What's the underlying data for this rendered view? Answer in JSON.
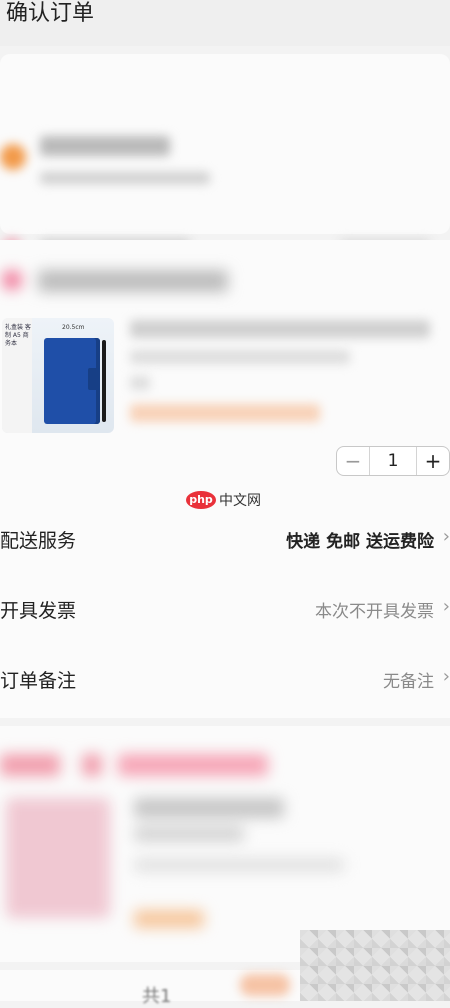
{
  "header": {
    "title": "确认订单"
  },
  "product": {
    "thumbnail": {
      "tag_text": "礼盒装 客制 A5 商务本",
      "dimension_text": "20.5cm"
    },
    "quantity": {
      "minus_icon": "−",
      "value": "1",
      "plus_icon": "+"
    }
  },
  "watermark": {
    "logo_text": "php",
    "site_text": "中文网"
  },
  "order_rows": [
    {
      "label": "配送服务",
      "value": "快递 免邮 送运费险",
      "chevron": "›"
    },
    {
      "label": "开具发票",
      "value": "本次不开具发票",
      "chevron": "›"
    },
    {
      "label": "订单备注",
      "value": "无备注",
      "chevron": "›"
    }
  ],
  "footer": {
    "total_prefix": "共1"
  },
  "colors": {
    "accent_orange": "#f29a4a",
    "watermark_red": "#e9313a",
    "notebook_blue": "#1f4fa8"
  }
}
